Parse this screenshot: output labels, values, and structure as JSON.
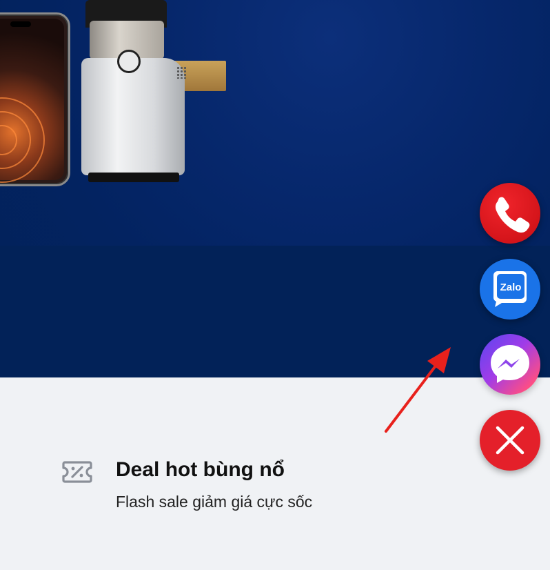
{
  "deal": {
    "icon": "discount-ticket-icon",
    "title": "Deal hot bùng nổ",
    "subtitle": "Flash sale giảm giá cực sốc"
  },
  "contact_buttons": {
    "phone": {
      "icon": "phone-icon"
    },
    "zalo": {
      "icon": "zalo-icon",
      "label": "Zalo"
    },
    "messenger": {
      "icon": "messenger-icon"
    },
    "close": {
      "icon": "close-icon"
    }
  },
  "hero": {
    "products": [
      "smartphone",
      "slow-juicer"
    ]
  },
  "colors": {
    "hero_background": "#022258",
    "page_background": "#f0f2f5",
    "phone_button": "#d4141a",
    "zalo_button": "#1a73e8",
    "close_button": "#e4202a",
    "annotation_arrow": "#e8211c"
  }
}
